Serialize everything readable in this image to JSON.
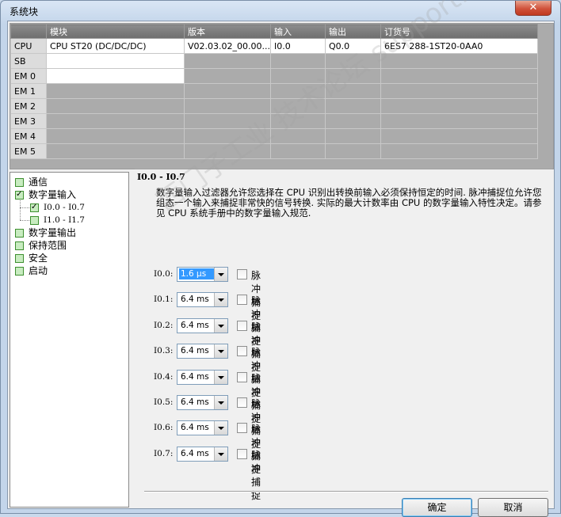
{
  "window": {
    "title": "系统块",
    "close_label": "✕"
  },
  "grid": {
    "headers": [
      "模块",
      "版本",
      "输入",
      "输出",
      "订货号"
    ],
    "rows": [
      {
        "slot": "CPU",
        "module": "CPU ST20 (DC/DC/DC)",
        "version": "V02.03.02_00.00...",
        "input": "I0.0",
        "output": "Q0.0",
        "order": "6ES7 288-1ST20-0AA0"
      },
      {
        "slot": "SB",
        "module": "",
        "version": "",
        "input": "",
        "output": "",
        "order": ""
      },
      {
        "slot": "EM 0",
        "module": "",
        "version": "",
        "input": "",
        "output": "",
        "order": ""
      },
      {
        "slot": "EM 1",
        "module": "",
        "version": "",
        "input": "",
        "output": "",
        "order": ""
      },
      {
        "slot": "EM 2",
        "module": "",
        "version": "",
        "input": "",
        "output": "",
        "order": ""
      },
      {
        "slot": "EM 3",
        "module": "",
        "version": "",
        "input": "",
        "output": "",
        "order": ""
      },
      {
        "slot": "EM 4",
        "module": "",
        "version": "",
        "input": "",
        "output": "",
        "order": ""
      },
      {
        "slot": "EM 5",
        "module": "",
        "version": "",
        "input": "",
        "output": "",
        "order": ""
      }
    ]
  },
  "tree": {
    "items": [
      {
        "label": "通信",
        "checked": false
      },
      {
        "label": "数字量输入",
        "checked": true
      },
      {
        "label": "I0.0 - I0.7",
        "checked": true
      },
      {
        "label": "I1.0 - I1.7",
        "checked": false
      },
      {
        "label": "数字量输出",
        "checked": false
      },
      {
        "label": "保持范围",
        "checked": false
      },
      {
        "label": "安全",
        "checked": false
      },
      {
        "label": "启动",
        "checked": false
      }
    ]
  },
  "panel": {
    "section_title": "I0.0 - I0.7",
    "description": "数字量输入过滤器允许您选择在 CPU 识别出转换前输入必须保持恒定的时间. 脉冲捕捉位允许您组态一个输入来捕捉非常快的信号转换. 实际的最大计数率由 CPU 的数字量输入特性决定。请参见 CPU 系统手册中的数字量输入规范.",
    "inputs": [
      {
        "label": "I0.0:",
        "filter": "1.6 μs",
        "pulse_label": "脉冲捕捉",
        "pulse_checked": false
      },
      {
        "label": "I0.1:",
        "filter": "6.4 ms",
        "pulse_label": "脉冲捕捉",
        "pulse_checked": false
      },
      {
        "label": "I0.2:",
        "filter": "6.4 ms",
        "pulse_label": "脉冲捕捉",
        "pulse_checked": false
      },
      {
        "label": "I0.3:",
        "filter": "6.4 ms",
        "pulse_label": "脉冲捕捉",
        "pulse_checked": false
      },
      {
        "label": "I0.4:",
        "filter": "6.4 ms",
        "pulse_label": "脉冲捕捉",
        "pulse_checked": false
      },
      {
        "label": "I0.5:",
        "filter": "6.4 ms",
        "pulse_label": "脉冲捕捉",
        "pulse_checked": false
      },
      {
        "label": "I0.6:",
        "filter": "6.4 ms",
        "pulse_label": "脉冲捕捉",
        "pulse_checked": false
      },
      {
        "label": "I0.7:",
        "filter": "6.4 ms",
        "pulse_label": "脉冲捕捉",
        "pulse_checked": false
      }
    ]
  },
  "buttons": {
    "ok": "确定",
    "cancel": "取消"
  },
  "watermark": "西门子工业 技术论坛 support.industry.siemens.com"
}
